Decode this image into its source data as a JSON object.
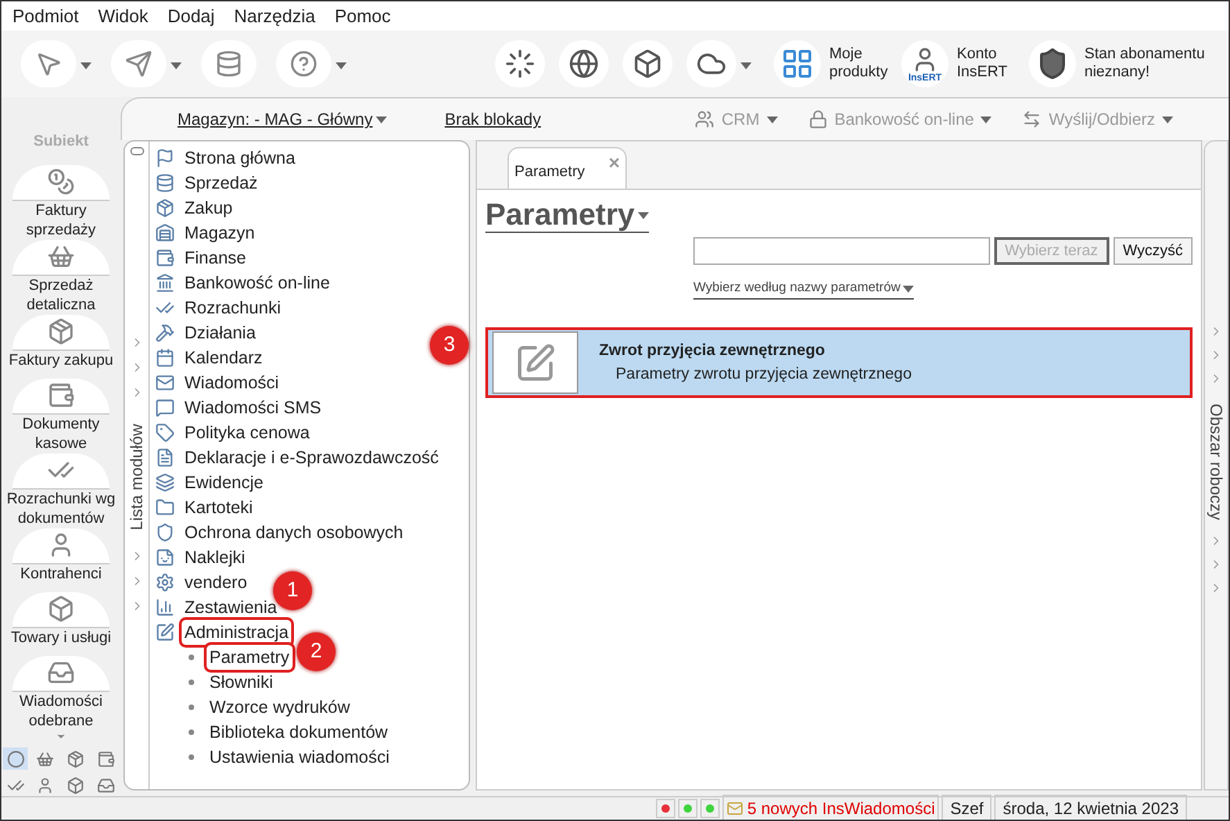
{
  "menu": [
    "Podmiot",
    "Widok",
    "Dodaj",
    "Narzędzia",
    "Pomoc"
  ],
  "toolbar": {
    "right_items": [
      {
        "label": "Moje produkty"
      },
      {
        "label": "Konto InsERT",
        "badge": "InsERT"
      },
      {
        "label": "Stan abonamentu nieznany!"
      }
    ]
  },
  "sidebar": {
    "logo": "Subiekt",
    "items": [
      {
        "label": "Faktury sprzedaży"
      },
      {
        "label": "Sprzedaż detaliczna"
      },
      {
        "label": "Faktury zakupu"
      },
      {
        "label": "Dokumenty kasowe"
      },
      {
        "label": "Rozrachunki wg dokumentów"
      },
      {
        "label": "Kontrahenci"
      },
      {
        "label": "Towary i usługi"
      },
      {
        "label": "Wiadomości odebrane"
      }
    ],
    "shortcuts": [
      {
        "selected": true
      },
      {
        "selected": false
      },
      {
        "selected": false
      },
      {
        "selected": false
      },
      {
        "selected": false
      },
      {
        "selected": false
      },
      {
        "selected": false
      },
      {
        "selected": false
      }
    ]
  },
  "header": {
    "warehouse": "Magazyn: - MAG - Główny",
    "lock": "Brak blokady",
    "actions": [
      {
        "label": "CRM"
      },
      {
        "label": "Bankowość on-line"
      },
      {
        "label": "Wyślij/Odbierz"
      }
    ]
  },
  "modules": {
    "title": "Lista modułów",
    "items": [
      {
        "label": "Strona główna",
        "framed": false
      },
      {
        "label": "Sprzedaż",
        "framed": false
      },
      {
        "label": "Zakup",
        "framed": false
      },
      {
        "label": "Magazyn",
        "framed": false
      },
      {
        "label": "Finanse",
        "framed": false
      },
      {
        "label": "Bankowość on-line",
        "framed": false
      },
      {
        "label": "Rozrachunki",
        "framed": false
      },
      {
        "label": "Działania",
        "framed": false
      },
      {
        "label": "Kalendarz",
        "framed": false
      },
      {
        "label": "Wiadomości",
        "framed": false
      },
      {
        "label": "Wiadomości SMS",
        "framed": false
      },
      {
        "label": "Polityka cenowa",
        "framed": false
      },
      {
        "label": "Deklaracje i e-Sprawozdawczość",
        "framed": false
      },
      {
        "label": "Ewidencje",
        "framed": false
      },
      {
        "label": "Kartoteki",
        "framed": false
      },
      {
        "label": "Ochrona danych osobowych",
        "framed": false
      },
      {
        "label": "Naklejki",
        "framed": false
      },
      {
        "label": "vendero",
        "framed": false
      },
      {
        "label": "Zestawienia",
        "framed": false
      },
      {
        "label": "Administracja",
        "framed": true,
        "expanded": true,
        "children": [
          {
            "label": "Parametry",
            "framed": true
          },
          {
            "label": "Słowniki",
            "framed": false
          },
          {
            "label": "Wzorce wydruków",
            "framed": false
          },
          {
            "label": "Biblioteka dokumentów",
            "framed": false
          },
          {
            "label": "Ustawienia wiadomości",
            "framed": false
          }
        ]
      }
    ]
  },
  "tabs": [
    {
      "label": "Parametry",
      "close": "×",
      "selected": true
    }
  ],
  "page": {
    "title": "Parametry",
    "buttons": [
      {
        "label": "Wybierz teraz",
        "disabled": true
      },
      {
        "label": "Wyczyść",
        "disabled": false
      }
    ],
    "filter": "Wybierz według nazwy parametrów",
    "results": [
      {
        "title": "Zwrot przyjęcia zewnętrznego",
        "subtitle": "Parametry zwrotu przyjęcia zewnętrznego",
        "selected": true,
        "framed": true
      }
    ]
  },
  "right_panel": {
    "title": "Obszar roboczy"
  },
  "annotations": [
    {
      "label": "1"
    },
    {
      "label": "2"
    },
    {
      "label": "3"
    }
  ],
  "status_bar": {
    "lights": [
      {
        "color": "#e8303a"
      },
      {
        "color": "#3ed43e"
      },
      {
        "color": "#3ed43e"
      }
    ],
    "messages": "5 nowych InsWiadomości",
    "user": "Szef",
    "date": "środa, 12 kwietnia 2023"
  }
}
